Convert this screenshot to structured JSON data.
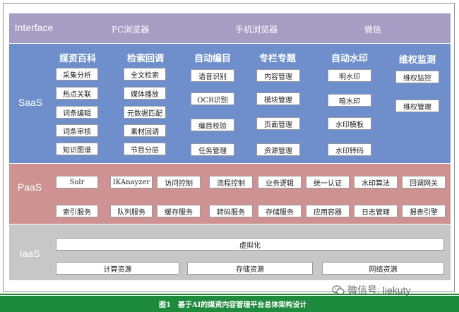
{
  "interface": {
    "label": "Interface",
    "items": [
      "PC浏览器",
      "手机浏览器",
      "微信"
    ]
  },
  "saas": {
    "label": "SaaS",
    "columns": [
      {
        "title": "媒资百科",
        "items": [
          "采集分析",
          "热点关联",
          "词条编辑",
          "词条审核",
          "知识图谱"
        ]
      },
      {
        "title": "检索回调",
        "items": [
          "全文检索",
          "媒体播放",
          "元数据匹配",
          "素材回调",
          "节目分层"
        ]
      },
      {
        "title": "自动编目",
        "items": [
          "语音识别",
          "OCR识别",
          "编目校验",
          "任务管理"
        ]
      },
      {
        "title": "专栏专题",
        "items": [
          "内容管理",
          "模块管理",
          "页面管理",
          "资源管理"
        ]
      },
      {
        "title": "自动水印",
        "items": [
          "明水印",
          "暗水印",
          "水印模板",
          "水印转码"
        ]
      },
      {
        "title": "维权监测",
        "items": [
          "维权监控",
          "维权管理"
        ]
      }
    ]
  },
  "paas": {
    "label": "PaaS",
    "row1": [
      "Solr",
      "IKAnayzer",
      "访问控制",
      "流程控制",
      "业务逻辑",
      "统一认证",
      "水印算法",
      "回调网关"
    ],
    "row2": [
      "索引服务",
      "队列服务",
      "缓存服务",
      "转码服务",
      "存储服务",
      "应用容器",
      "日志管理",
      "报表引擎"
    ]
  },
  "iaas": {
    "label": "IaaS",
    "virtual": "虚拟化",
    "resources": [
      "计算资源",
      "存储资源",
      "网络资源"
    ]
  },
  "caption": "图1　基于AI的媒资内容管理平台总体架构设计",
  "watermark": "微信号: liekuty",
  "colors": {
    "interface_band": "#a79cc4",
    "saas_band": "#6e8fcc",
    "paas_band": "#cf9293",
    "iaas_band": "#c7c7c7",
    "caption_bar": "#1e8a3c"
  }
}
